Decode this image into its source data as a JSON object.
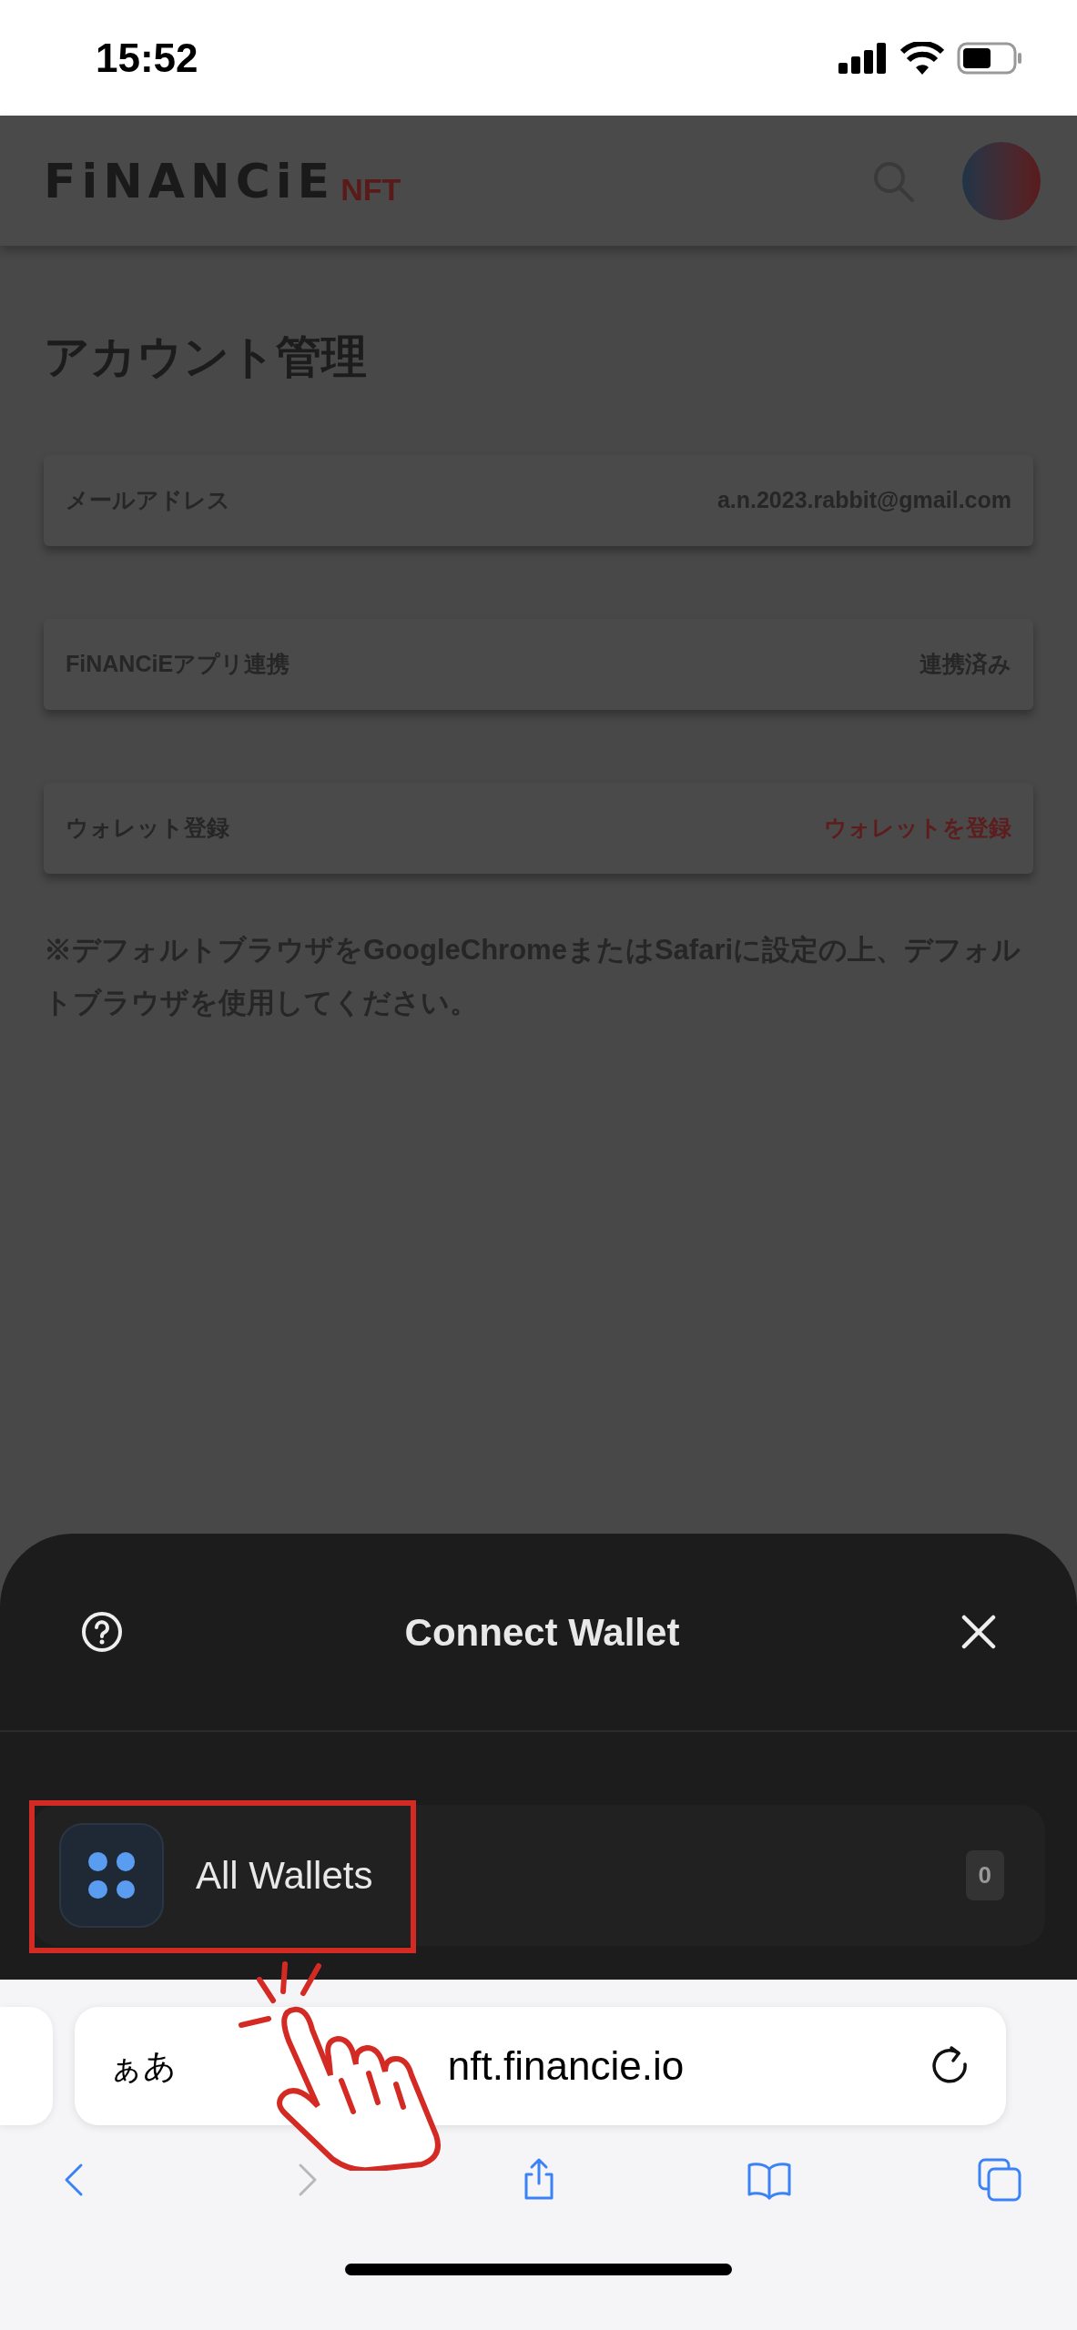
{
  "status_bar": {
    "time": "15:52"
  },
  "header": {
    "logo": "FiNANCiE",
    "logo_suffix": "NFT"
  },
  "page": {
    "title": "アカウント管理",
    "rows": [
      {
        "label": "メールアドレス",
        "value": "a.n.2023.rabbit@gmail.com",
        "kind": "text"
      },
      {
        "label": "FiNANCiEアプリ連携",
        "value": "連携済み",
        "kind": "text"
      },
      {
        "label": "ウォレット登録",
        "value": "ウォレットを登録",
        "kind": "link"
      }
    ],
    "note": "※デフォルトブラウザをGoogleChromeまたはSafariに設定の上、デフォルトブラウザを使用してください。"
  },
  "modal": {
    "title": "Connect Wallet",
    "wallets": [
      {
        "name": "All Wallets",
        "count": "0",
        "highlighted": true
      }
    ]
  },
  "browser": {
    "text_size": "ぁあ",
    "url": "nft.financie.io",
    "toolbar": [
      {
        "kind": "back",
        "disabled": false
      },
      {
        "kind": "forward",
        "disabled": true
      },
      {
        "kind": "share",
        "disabled": false
      },
      {
        "kind": "bookmarks",
        "disabled": false
      },
      {
        "kind": "tabs",
        "disabled": false
      }
    ]
  }
}
